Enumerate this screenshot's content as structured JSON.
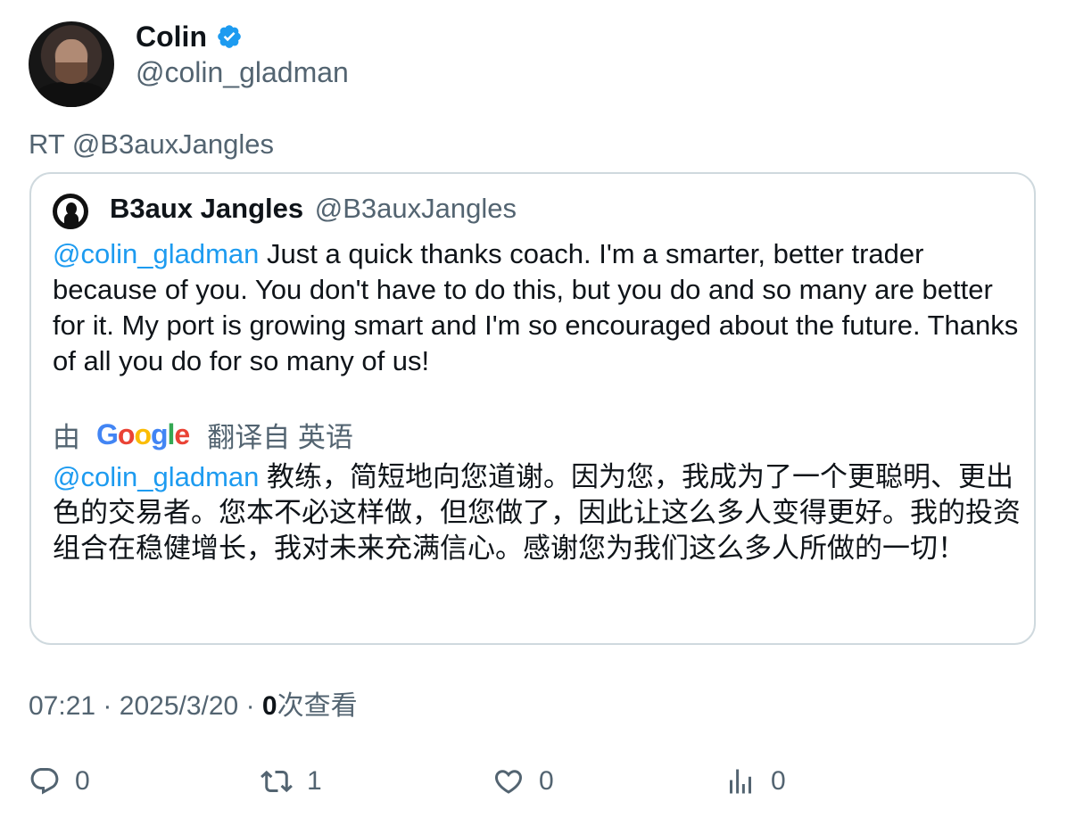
{
  "author": {
    "name": "Colin",
    "handle": "@colin_gladman",
    "verified": true,
    "verified_color": "#1d9bf0"
  },
  "retweet_line": "RT @B3auxJangles",
  "quote": {
    "name": "B3aux Jangles",
    "handle": "@B3auxJangles",
    "mention": "@colin_gladman",
    "text": " Just a quick thanks coach.  I'm a smarter, better trader because of you.  You don't have to do this, but you do and so many are better for it.  My port is growing smart and I'm so encouraged about the future.  Thanks of all you do for so many of us!",
    "translation_prefix": "由",
    "translation_provider": "Google",
    "translation_suffix": "翻译自 英语",
    "translated_mention": "@colin_gladman",
    "translated_text": " 教练，简短地向您道谢。因为您，我成为了一个更聪明、更出色的交易者。您本不必这样做，但您做了，因此让这么多人变得更好。我的投资组合在稳健增长，我对未来充满信心。感谢您为我们这么多人所做的一切！"
  },
  "meta": {
    "time": "07:21",
    "separator": "·",
    "date": "2025/3/20",
    "views_count": "0",
    "views_label": "次查看"
  },
  "actions": {
    "replies": "0",
    "retweets": "1",
    "likes": "0",
    "views": "0"
  },
  "colors": {
    "mention": "#1d9bf0",
    "secondary_text": "#536471",
    "border": "#cfd9de"
  },
  "icons": [
    "verified-badge-icon",
    "reply-icon",
    "retweet-icon",
    "like-icon",
    "views-icon"
  ]
}
